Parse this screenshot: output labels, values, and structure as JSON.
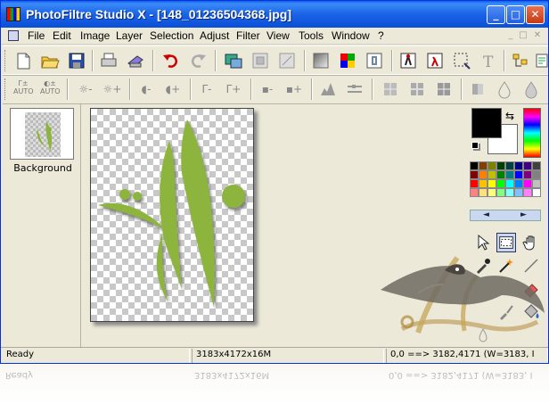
{
  "window": {
    "title": "PhotoFiltre Studio X - [148_01236504368.jpg]",
    "controls": [
      "_",
      "□",
      "✕"
    ]
  },
  "menu": {
    "items": [
      "File",
      "Edit",
      "Image",
      "Layer",
      "Selection",
      "Adjust",
      "Filter",
      "View",
      "Tools",
      "Window",
      "?"
    ]
  },
  "toolbar1": {
    "icons": [
      "new-icon",
      "open-icon",
      "save-icon",
      "print-icon",
      "scan-icon",
      "undo-icon",
      "redo-icon",
      "image-size-icon",
      "canvas-size-icon",
      "fit-icon",
      "gradient-icon",
      "color-icon",
      "transparency-icon",
      "contrast-icon",
      "run-icon",
      "selection-icon",
      "text-icon",
      "explorer-icon",
      "preferences-icon"
    ],
    "text_button": "T"
  },
  "toolbar2": {
    "auto_label": "AUTO",
    "icons": [
      "auto-levels-icon",
      "auto-contrast-icon",
      "brightness-minus-icon",
      "brightness-plus-icon",
      "contrast-minus-icon",
      "contrast-plus-icon",
      "saturation-minus-icon",
      "saturation-plus-icon",
      "gamma-minus-icon",
      "gamma-plus-icon",
      "color-minus-icon",
      "color-plus-icon",
      "levels-icon",
      "histogram-icon",
      "blur-icon",
      "soften-icon",
      "sharpen-icon",
      "noise-icon",
      "drop-icon",
      "water-icon"
    ]
  },
  "layers": {
    "items": [
      {
        "name": "Background"
      }
    ]
  },
  "palette": {
    "colors": {
      "foreground": "#000000",
      "background": "#ffffff",
      "accent_green": "#8db43c"
    },
    "swatches": [
      "#000000",
      "#804000",
      "#808000",
      "#004000",
      "#004040",
      "#000080",
      "#400080",
      "#404040",
      "#800000",
      "#ff8000",
      "#c0c000",
      "#008000",
      "#008080",
      "#0000ff",
      "#800080",
      "#808080",
      "#ff0000",
      "#ffc000",
      "#ffff00",
      "#00ff00",
      "#00ffff",
      "#0080ff",
      "#ff00ff",
      "#c0c0c0",
      "#ff8080",
      "#ffe080",
      "#ffff80",
      "#80ff80",
      "#80ffff",
      "#80c0ff",
      "#ff80ff",
      "#ffffff"
    ],
    "nav_left": "◄",
    "nav_right": "►"
  },
  "tools": [
    "arrow-icon",
    "selection-tool-icon",
    "hand-icon",
    "eyedropper-icon",
    "magic-wand-icon",
    "line-icon",
    "eraser-icon",
    "brush-icon",
    "fill-icon",
    "smudge-icon"
  ],
  "status": {
    "state": "Ready",
    "image_size": "3183x4172x16M",
    "coords": "0,0 ==> 3182,4171 (W=3183, I"
  }
}
